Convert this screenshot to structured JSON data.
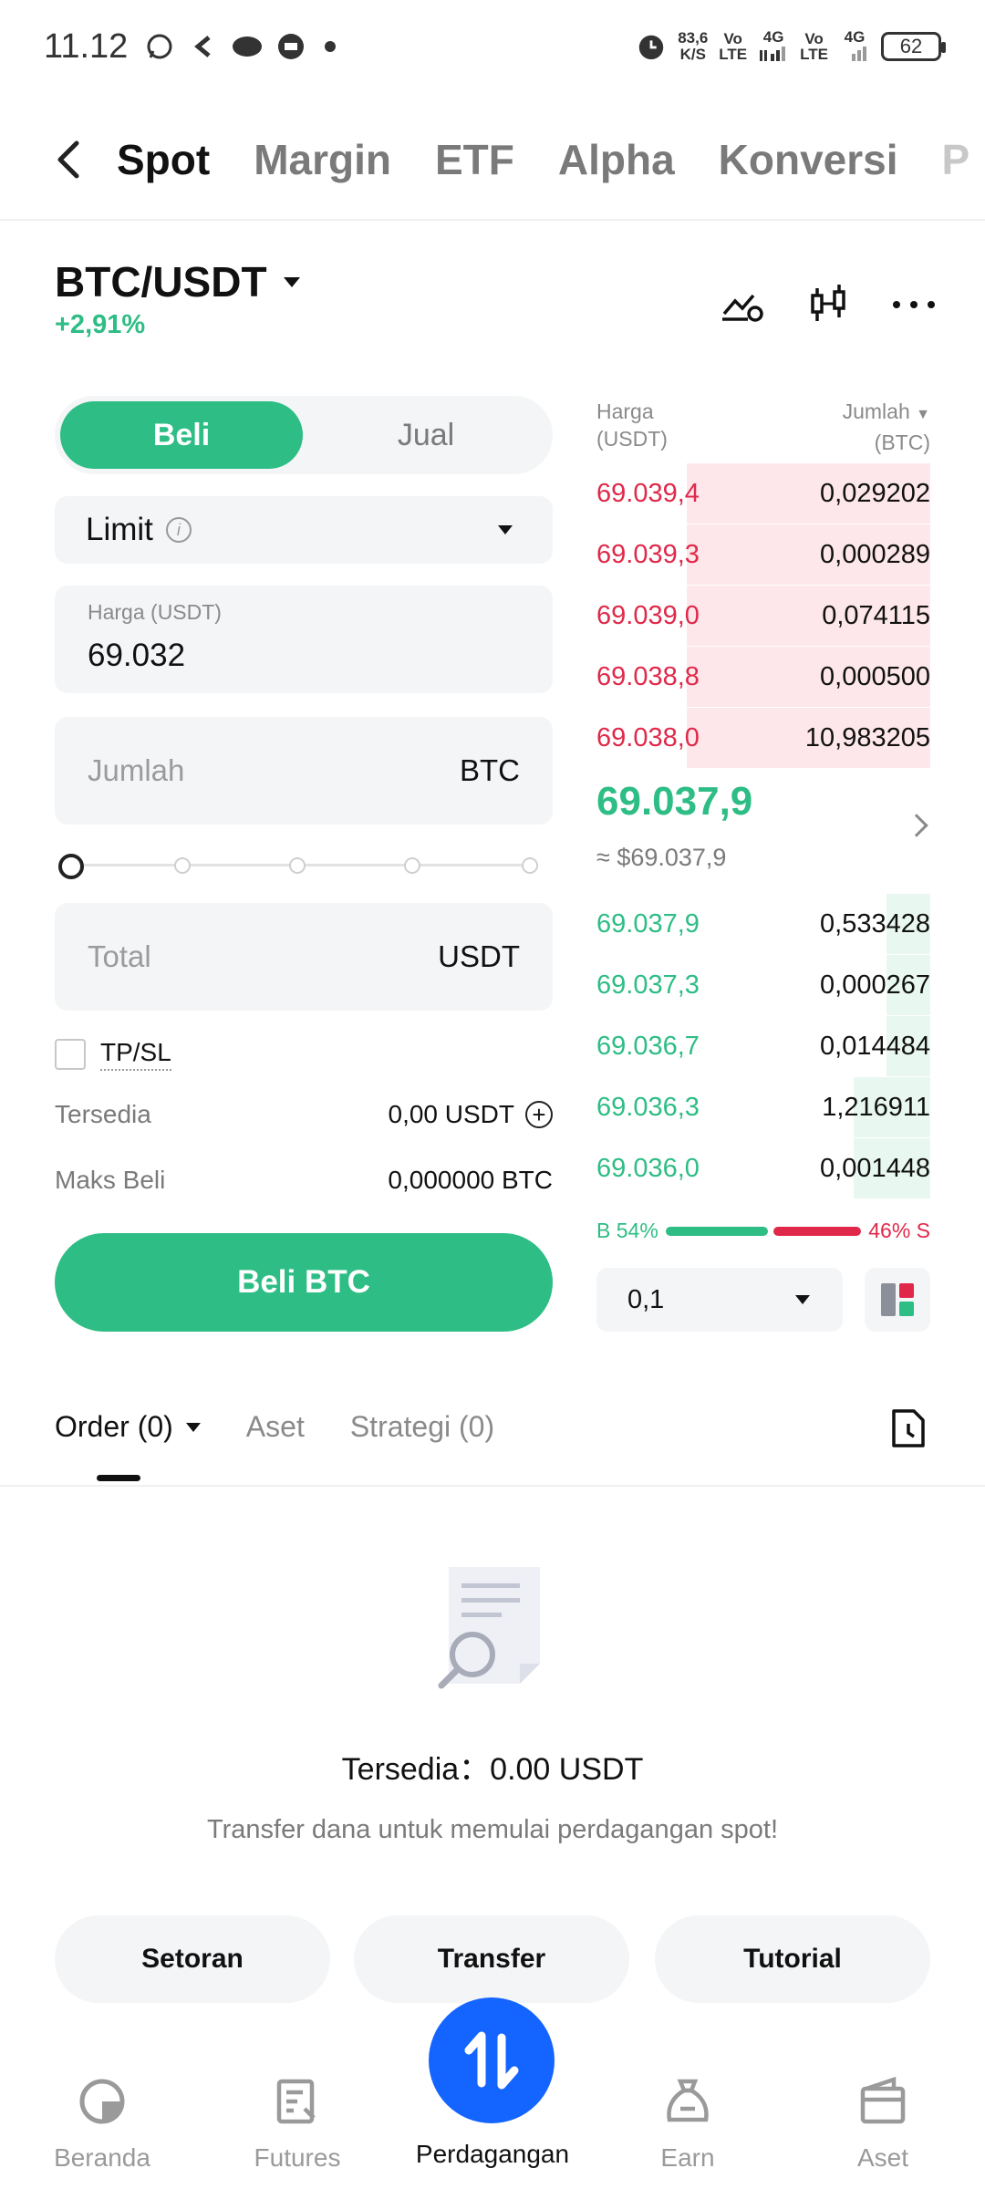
{
  "status_bar": {
    "time": "11.12",
    "speed_value": "83,6",
    "speed_unit": "K/S",
    "net1_a": "Vo",
    "net1_b": "LTE",
    "net1_gen": "4G",
    "net2_a": "Vo",
    "net2_b": "LTE",
    "net2_gen": "4G",
    "battery": "62"
  },
  "top_tabs": {
    "items": [
      {
        "label": "Spot",
        "active": true
      },
      {
        "label": "Margin",
        "active": false
      },
      {
        "label": "ETF",
        "active": false
      },
      {
        "label": "Alpha",
        "active": false
      },
      {
        "label": "Konversi",
        "active": false
      },
      {
        "label": "P",
        "active": false
      }
    ]
  },
  "pair": {
    "name": "BTC/USDT",
    "change": "+2,91%"
  },
  "form": {
    "buy_label": "Beli",
    "sell_label": "Jual",
    "order_type": "Limit",
    "price_label": "Harga (USDT)",
    "price_value": "69.032",
    "amount_placeholder": "Jumlah",
    "amount_unit": "BTC",
    "total_placeholder": "Total",
    "total_unit": "USDT",
    "tpsl_label": "TP/SL",
    "available_label": "Tersedia",
    "available_value": "0,00 USDT",
    "max_buy_label": "Maks Beli",
    "max_buy_value": "0,000000 BTC",
    "submit_label": "Beli BTC",
    "slider_percent": 0
  },
  "order_book": {
    "price_header_1": "Harga",
    "price_header_2": "(USDT)",
    "qty_header_1": "Jumlah",
    "qty_header_2": "(BTC)",
    "asks": [
      {
        "price": "69.039,4",
        "qty": "0,029202",
        "depth": 0.73
      },
      {
        "price": "69.039,3",
        "qty": "0,000289",
        "depth": 0.73
      },
      {
        "price": "69.039,0",
        "qty": "0,074115",
        "depth": 0.73
      },
      {
        "price": "69.038,8",
        "qty": "0,000500",
        "depth": 0.73
      },
      {
        "price": "69.038,0",
        "qty": "10,983205",
        "depth": 0.73
      }
    ],
    "mid_price": "69.037,9",
    "mid_usd": "≈ $69.037,9",
    "bids": [
      {
        "price": "69.037,9",
        "qty": "0,533428",
        "depth": 0.13
      },
      {
        "price": "69.037,3",
        "qty": "0,000267",
        "depth": 0.13
      },
      {
        "price": "69.036,7",
        "qty": "0,014484",
        "depth": 0.13
      },
      {
        "price": "69.036,3",
        "qty": "1,216911",
        "depth": 0.23
      },
      {
        "price": "69.036,0",
        "qty": "0,001448",
        "depth": 0.23
      }
    ],
    "buy_ratio_label": "B 54%",
    "sell_ratio_label": "46% S",
    "buy_ratio": 54,
    "sell_ratio": 46,
    "depth_value": "0,1"
  },
  "orders": {
    "tab_order": "Order (0)",
    "tab_assets": "Aset",
    "tab_strategy": "Strategi (0)",
    "empty_title": "Tersedia：0.00 USDT",
    "empty_subtitle": "Transfer dana untuk memulai perdagangan spot!",
    "btn_deposit": "Setoran",
    "btn_transfer": "Transfer",
    "btn_tutorial": "Tutorial"
  },
  "bottom_nav": {
    "home": "Beranda",
    "futures": "Futures",
    "trade": "Perdagangan",
    "earn": "Earn",
    "assets": "Aset"
  },
  "colors": {
    "buy_green": "#2ebd85",
    "sell_red": "#e0294a",
    "primary_blue": "#1465ff"
  }
}
